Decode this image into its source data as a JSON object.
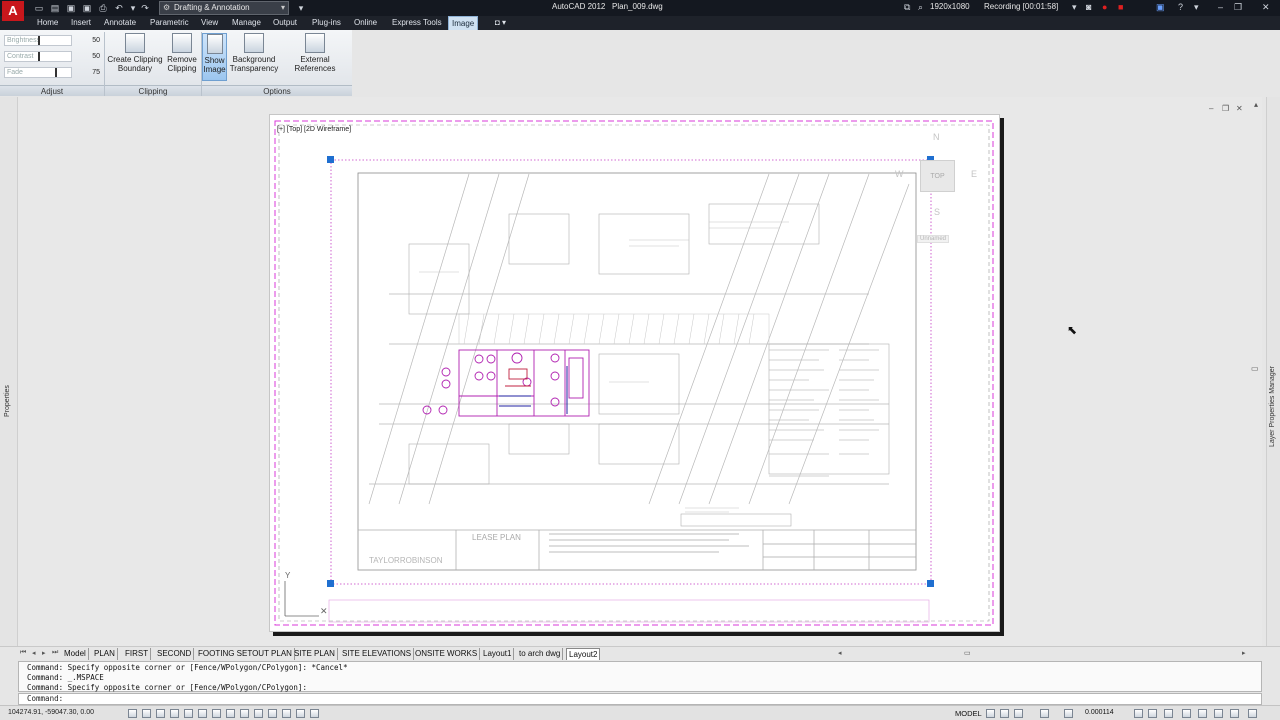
{
  "titlebar": {
    "workspace": "Drafting & Annotation",
    "title": "AutoCAD 2012   Plan_009.dwg",
    "resolution": "1920x1080",
    "recording": "Recording [00:01:58]"
  },
  "ribbon_tabs": [
    "Home",
    "Insert",
    "Annotate",
    "Parametric",
    "View",
    "Manage",
    "Output",
    "Plug-ins",
    "Online",
    "Express Tools",
    "Image"
  ],
  "active_tab": "Image",
  "adjust": {
    "rows": [
      {
        "label": "Brightness",
        "value": "50",
        "fraction": 0.5
      },
      {
        "label": "Contrast",
        "value": "50",
        "fraction": 0.5
      },
      {
        "label": "Fade",
        "value": "75",
        "fraction": 0.75
      }
    ],
    "title": "Adjust"
  },
  "clipping": {
    "create": "Create Clipping Boundary",
    "create_l1": "Create Clipping",
    "create_l2": "Boundary",
    "remove_l1": "Remove",
    "remove_l2": "Clipping",
    "title": "Clipping"
  },
  "options": {
    "show_l1": "Show",
    "show_l2": "Image",
    "bg_l1": "Background",
    "bg_l2": "Transparency",
    "ext_refs": "External References",
    "title": "Options"
  },
  "viewport": {
    "label": "[+] [Top] [2D Wireframe]",
    "viewcube_face": "TOP",
    "compass": {
      "n": "N",
      "s": "S",
      "e": "E",
      "w": "W"
    },
    "wcs": "Unnamed"
  },
  "drawing": {
    "title_block_title": "LEASE PLAN",
    "company": "TAYLORROBINSON"
  },
  "side_panels": {
    "left": "Properties",
    "right": "Layer Properties Manager"
  },
  "layout_tabs": [
    "Model",
    "PLAN",
    "FIRST",
    "SECOND",
    "FOOTING SETOUT PLAN",
    "SITE PLAN",
    "SITE ELEVATIONS",
    "ONSITE WORKS",
    "Layout1",
    "to arch dwg",
    "Layout2"
  ],
  "active_layout": "Layout2",
  "command": {
    "lines": [
      "Command: Specify opposite corner or [Fence/WPolygon/CPolygon]: *Cancel*",
      "Command: _.MSPACE",
      "Command: Specify opposite corner or [Fence/WPolygon/CPolygon]:"
    ],
    "prompt": "Command:"
  },
  "status": {
    "coords": "104274.91, -59047.30, 0.00",
    "space": "MODEL",
    "anno_scale": "0.000114"
  },
  "colors": {
    "accent": "#cfe1f2",
    "titlebar": "#141820",
    "grip": "#1f6fd0",
    "viewport_border": "#d83ad8"
  }
}
